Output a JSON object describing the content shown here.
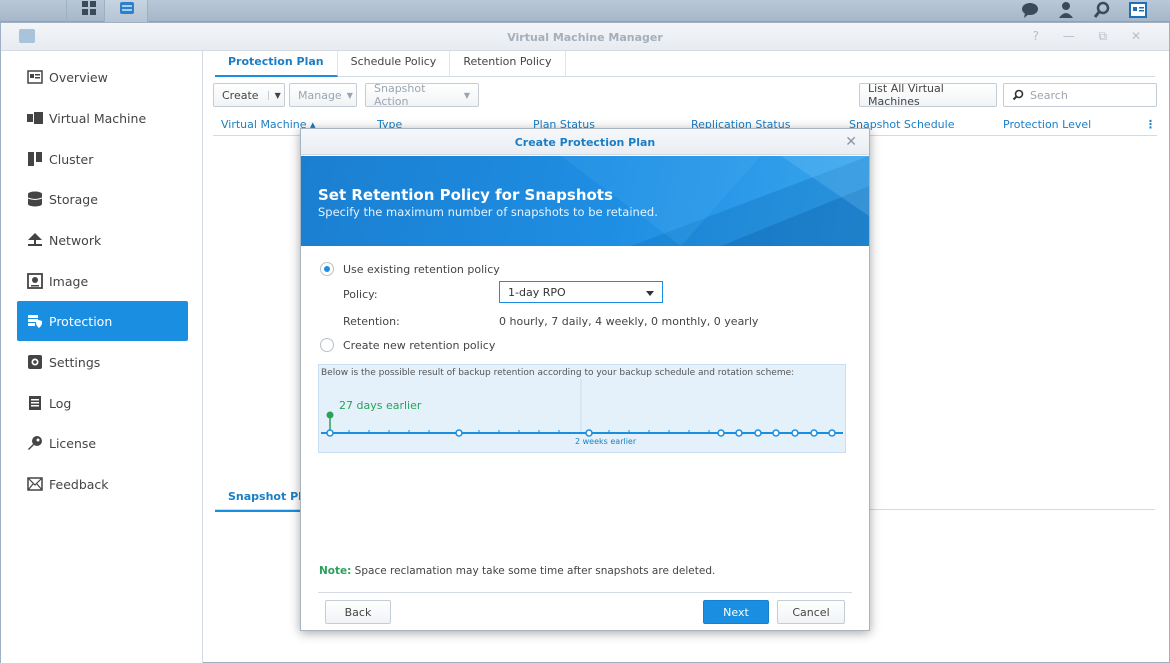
{
  "window": {
    "title": "Virtual Machine Manager",
    "controls": "? — ⧉ ✕"
  },
  "sidebar": {
    "items": [
      {
        "label": "Overview",
        "icon": "overview-icon"
      },
      {
        "label": "Virtual Machine",
        "icon": "virtual-machine-icon"
      },
      {
        "label": "Cluster",
        "icon": "cluster-icon"
      },
      {
        "label": "Storage",
        "icon": "storage-icon"
      },
      {
        "label": "Network",
        "icon": "network-icon"
      },
      {
        "label": "Image",
        "icon": "image-icon"
      },
      {
        "label": "Protection",
        "icon": "protection-icon",
        "active": true
      },
      {
        "label": "Settings",
        "icon": "gear-icon"
      },
      {
        "label": "Log",
        "icon": "log-icon"
      },
      {
        "label": "License",
        "icon": "key-icon"
      },
      {
        "label": "Feedback",
        "icon": "mail-icon"
      }
    ]
  },
  "tabs": [
    "Protection Plan",
    "Schedule Policy",
    "Retention Policy"
  ],
  "toolbar": {
    "create": "Create",
    "manage": "Manage",
    "snapshot_action": "Snapshot Action",
    "list_all": "List All Virtual Machines",
    "search_placeholder": "Search"
  },
  "grid": {
    "columns": [
      "Virtual Machine",
      "Type",
      "Plan Status",
      "Replication Status",
      "Snapshot Schedule",
      "Protection Level"
    ]
  },
  "lower_tab": "Snapshot Plan",
  "dialog": {
    "title": "Create Protection Plan",
    "heading": "Set Retention Policy for Snapshots",
    "subheading": "Specify the maximum number of snapshots to be retained.",
    "option_existing": "Use existing retention policy",
    "policy_label": "Policy:",
    "policy_value": "1-day RPO",
    "retention_label": "Retention:",
    "retention_value": "0 hourly, 7 daily, 4 weekly, 0 monthly, 0 yearly",
    "option_new": "Create new retention policy",
    "timeline_desc": "Below is the possible result of backup retention according to your backup schedule and rotation scheme:",
    "timeline_first": "27 days earlier",
    "timeline_mid": "2 weeks earlier",
    "note_label": "Note:",
    "note_text": " Space reclamation may take some time after snapshots are deleted.",
    "back": "Back",
    "next": "Next",
    "cancel": "Cancel"
  },
  "colors": {
    "accent": "#1a8ee1",
    "green": "#2aa15a"
  }
}
